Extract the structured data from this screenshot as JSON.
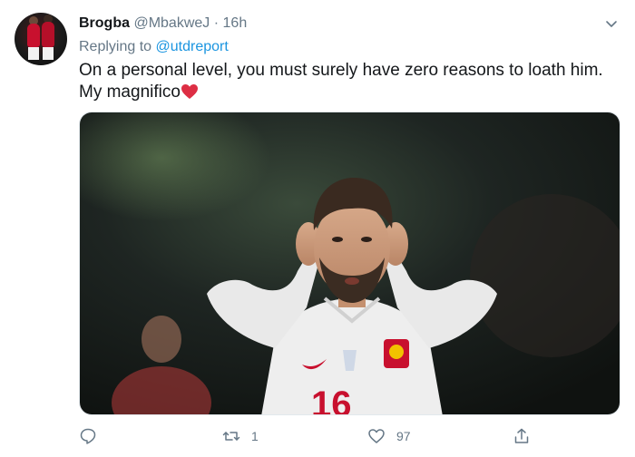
{
  "tweet": {
    "display_name": "Brogba",
    "handle": "@MbakweJ",
    "separator": "·",
    "time": "16h",
    "reply_prefix": "Replying to",
    "reply_mention": "@utdreport",
    "text": "On a personal level, you must surely have zero reasons to loath him. My magnifico",
    "emoji": "red-heart"
  },
  "actions": {
    "reply": {
      "icon": "reply-icon",
      "count": ""
    },
    "retweet": {
      "icon": "retweet-icon",
      "count": "1"
    },
    "like": {
      "icon": "heart-icon",
      "count": "97"
    },
    "share": {
      "icon": "share-icon",
      "count": ""
    }
  },
  "colors": {
    "name": "#14171a",
    "secondary": "#657786",
    "link": "#1b95e0",
    "heart": "#e0245e",
    "jersey_number": "#c8102e"
  },
  "media": {
    "jersey_number": "16"
  }
}
